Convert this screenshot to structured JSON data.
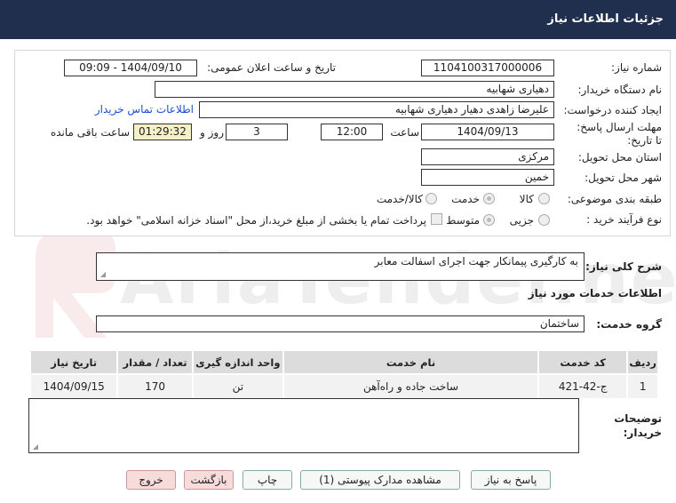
{
  "header": {
    "title": "جزئیات اطلاعات نیاز"
  },
  "labels": {
    "need_number": "شماره نیاز:",
    "announce_datetime": "تاریخ و ساعت اعلان عمومی:",
    "buyer_org": "نام دستگاه خریدار:",
    "requester": "ایجاد کننده درخواست:",
    "contact_link": "اطلاعات تماس خریدار",
    "deadline": "مهلت ارسال پاسخ: تا تاریخ:",
    "time": "ساعت",
    "days_and": "روز و",
    "remaining": "ساعت باقی مانده",
    "province": "استان محل تحویل:",
    "city": "شهر محل تحویل:",
    "category": "طبقه بندی موضوعی:",
    "process_type": "نوع فرآیند خرید :",
    "process_note": "پرداخت تمام یا بخشی از مبلغ خرید،از محل \"اسناد خزانه اسلامی\" خواهد بود.",
    "summary": "شرح کلی نیاز:",
    "services_info": "اطلاعات خدمات مورد نیاز",
    "service_group": "گروه خدمت:",
    "buyer_notes": "توضیحات خریدار:"
  },
  "values": {
    "need_number": "1104100317000006",
    "announce_datetime": "1404/09/10 - 09:09",
    "buyer_org": "دهیاری شهابیه",
    "requester": "علیرضا زاهدی دهیار دهیاری شهابیه",
    "deadline_date": "1404/09/13",
    "deadline_time": "12:00",
    "days": "3",
    "remaining_time": "01:29:32",
    "province": "مرکزی",
    "city": "خمین",
    "summary": "به کارگیری پیمانکار جهت اجرای اسفالت معابر",
    "service_group": "ساختمان",
    "buyer_notes": ""
  },
  "category_options": [
    {
      "label": "کالا",
      "selected": false
    },
    {
      "label": "خدمت",
      "selected": true
    },
    {
      "label": "کالا/خدمت",
      "selected": false
    }
  ],
  "process_options": [
    {
      "label": "جزیی",
      "selected": false
    },
    {
      "label": "متوسط",
      "selected": true
    }
  ],
  "table": {
    "headers": [
      "ردیف",
      "کد خدمت",
      "نام خدمت",
      "واحد اندازه گیری",
      "تعداد / مقدار",
      "تاریخ نیاز"
    ],
    "rows": [
      [
        "1",
        "ج-42-421",
        "ساخت جاده و راه‌آهن",
        "تن",
        "170",
        "1404/09/15"
      ]
    ]
  },
  "buttons": {
    "reply": "پاسخ به نیاز",
    "attachments": "مشاهده مدارک پیوستی (1)",
    "print": "چاپ",
    "back": "بازگشت",
    "exit": "خروج"
  },
  "watermark": {
    "text": "AriaTender.neT"
  },
  "colors": {
    "header_bg": "#1f2f4d",
    "timer_bg": "#f6f0c9",
    "link": "#1a4fd0",
    "danger_btn": "#f8dcdc"
  }
}
